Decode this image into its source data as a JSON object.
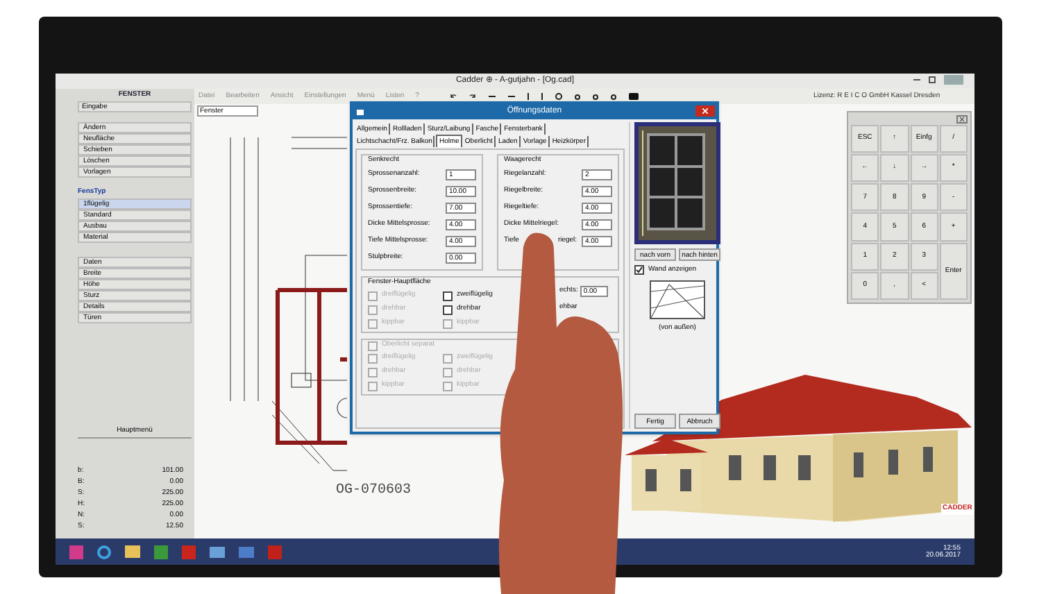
{
  "window": {
    "title": "Cadder ⊕ - A-gutjahn - [Og.cad]"
  },
  "menu": [
    "Datei",
    "Bearbeiten",
    "Ansicht",
    "Einstellungen",
    "Menü",
    "Listen",
    "?"
  ],
  "license": "Lizenz: R E I C O GmbH Kassel Dresden",
  "layer_select": "Fenster",
  "sidebar": {
    "header": "FENSTER",
    "subheader": "Eingabe",
    "actions": [
      "Ändern",
      "Neufläche",
      "Schieben",
      "Löschen",
      "Vorlagen"
    ],
    "type_heading": "FensTyp",
    "types": [
      {
        "label": "1flügelig",
        "selected": true
      },
      {
        "label": "Standard",
        "selected": false
      },
      {
        "label": "Ausbau",
        "selected": false
      },
      {
        "label": "Material",
        "selected": false
      }
    ],
    "data_items": [
      "Daten",
      "Breite",
      "Höhe",
      "Sturz",
      "Details",
      "Türen"
    ],
    "main_menu": "Hauptmenü",
    "readouts": [
      {
        "label": "b:",
        "value": "101.00"
      },
      {
        "label": "B:",
        "value": "0.00"
      },
      {
        "label": "S:",
        "value": "225.00"
      },
      {
        "label": "H:",
        "value": "225.00"
      },
      {
        "label": "N:",
        "value": "0.00"
      },
      {
        "label": "S:",
        "value": "12.50"
      }
    ]
  },
  "plan_label": "OG-070603",
  "logo": "CADDER",
  "dialog": {
    "title": "Öffnungsdaten",
    "tab_rows": [
      [
        {
          "label": "Allgemein",
          "selected": false
        },
        {
          "label": "Rollladen",
          "selected": false
        },
        {
          "label": "Sturz/Laibung",
          "selected": false
        },
        {
          "label": "Fasche",
          "selected": false
        },
        {
          "label": "Fensterbank",
          "selected": false
        }
      ],
      [
        {
          "label": "Lichtschacht/Frz. Balkon",
          "selected": false
        },
        {
          "label": "Holme",
          "selected": true
        },
        {
          "label": "Oberlicht",
          "selected": false
        },
        {
          "label": "Laden",
          "selected": false
        },
        {
          "label": "Vorlage",
          "selected": false
        },
        {
          "label": "Heizkörper",
          "selected": false
        }
      ]
    ],
    "vertical": {
      "title": "Senkrecht",
      "fields": [
        {
          "label": "Sprossenanzahl:",
          "value": "1"
        },
        {
          "label": "Sprossenbreite:",
          "value": "10.00"
        },
        {
          "label": "Sprossentiefe:",
          "value": "7.00"
        },
        {
          "label": "Dicke Mittelsprosse:",
          "value": "4.00"
        },
        {
          "label": "Tiefe Mittelsprosse:",
          "value": "4.00"
        },
        {
          "label": "Stulpbreite:",
          "value": "0.00"
        }
      ]
    },
    "horizontal": {
      "title": "Waagerecht",
      "fields": [
        {
          "label": "Riegelanzahl:",
          "value": "2"
        },
        {
          "label": "Riegelbreite:",
          "value": "4.00"
        },
        {
          "label": "Riegeltiefe:",
          "value": "4.00"
        },
        {
          "label": "Dicke Mittelriegel:",
          "value": "4.00"
        },
        {
          "label": "Tiefe",
          "label_tail": "riegel:",
          "value": "4.00"
        }
      ]
    },
    "main_area": {
      "title": "Fenster-Hauptfläche",
      "options": [
        {
          "label": "dreiflügelig",
          "checked": false,
          "disabled": true
        },
        {
          "label": "zweiflügelig",
          "checked": false,
          "disabled": false
        },
        {
          "label": "drehbar",
          "checked": false,
          "disabled": true
        },
        {
          "label": "drehbar",
          "checked": false,
          "disabled": false
        },
        {
          "label": "kippbar",
          "checked": false,
          "disabled": true
        },
        {
          "label": "kippbar",
          "checked": false,
          "disabled": true
        }
      ],
      "side_label": "echts:",
      "side_value": "0.00",
      "side_text": "ehbar"
    },
    "transom": {
      "title": "Oberlicht separat",
      "checked": false,
      "disabled": true,
      "options": [
        {
          "label": "dreiflügelig",
          "checked": false,
          "disabled": true
        },
        {
          "label": "zweiflügelig",
          "checked": false,
          "disabled": true
        },
        {
          "label": "drehbar",
          "checked": false,
          "disabled": true
        },
        {
          "label": "drehbar",
          "checked": false,
          "disabled": true
        },
        {
          "label": "kippbar",
          "checked": false,
          "disabled": true
        },
        {
          "label": "kippbar",
          "checked": false,
          "disabled": true
        }
      ]
    },
    "preview_buttons": [
      "nach vorn",
      "nach hinten"
    ],
    "wall": {
      "label": "Wand anzeigen",
      "checked": true
    },
    "wall_caption": "(von außen)",
    "buttons": [
      "Fertig",
      "Abbruch"
    ]
  },
  "keypad": {
    "keys": [
      {
        "label": "ESC",
        "kind": "key"
      },
      {
        "label": "↑",
        "kind": "key"
      },
      {
        "label": "Einfg",
        "kind": "key"
      },
      {
        "label": "/",
        "kind": "key"
      },
      {
        "label": "←",
        "kind": "key"
      },
      {
        "label": "↓",
        "kind": "key"
      },
      {
        "label": "→",
        "kind": "key"
      },
      {
        "label": "*",
        "kind": "key"
      },
      {
        "label": "7",
        "kind": "key"
      },
      {
        "label": "8",
        "kind": "key"
      },
      {
        "label": "9",
        "kind": "key"
      },
      {
        "label": "-",
        "kind": "key"
      },
      {
        "label": "4",
        "kind": "key"
      },
      {
        "label": "5",
        "kind": "key"
      },
      {
        "label": "6",
        "kind": "key"
      },
      {
        "label": "+",
        "kind": "key"
      },
      {
        "label": "1",
        "kind": "key"
      },
      {
        "label": "2",
        "kind": "key"
      },
      {
        "label": "3",
        "kind": "key"
      },
      {
        "label": "Enter",
        "kind": "tall"
      },
      {
        "label": "0",
        "kind": "key"
      },
      {
        "label": ",",
        "kind": "key"
      },
      {
        "label": "<",
        "kind": "key"
      }
    ]
  },
  "taskbar": {
    "time": "12:55",
    "date": "20.06.2017"
  }
}
